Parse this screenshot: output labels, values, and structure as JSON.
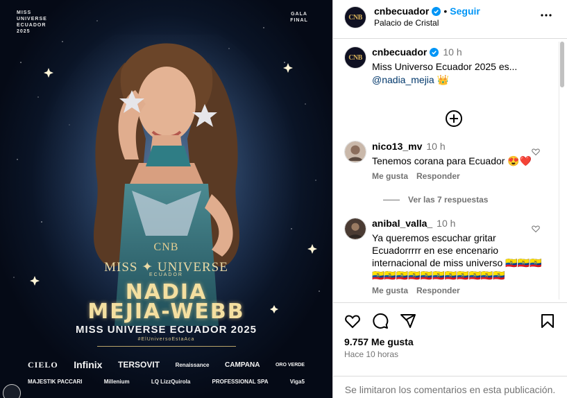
{
  "poster": {
    "corner_left": "MISS\nUNIVERSE\nECUADOR\n2025",
    "corner_right": "GALA\nFINAL",
    "cnb_logo": "CNB",
    "mu_line": "MISS ✦ UNIVERSE",
    "mu_sub": "ECUADOR",
    "name_line1": "NADIA",
    "name_line2": "MEJIA-WEBB",
    "title_line": "MISS UNIVERSE ECUADOR 2025",
    "hashtag": "#ElUniversoEstaAca",
    "sponsors_row1": [
      "CIELO",
      "Infinix",
      "TERSOVIT",
      "Renaissance",
      "CAMPANA",
      "ORO VERDE"
    ],
    "sponsors_row2": [
      "MAJESTIK PACCARI",
      "Millenium",
      "LQ LizzQuirola",
      "PROFESSIONAL SPA",
      "Viga5"
    ]
  },
  "header": {
    "avatar_text": "CNB",
    "username": "cnbecuador",
    "follow_label": "Seguir",
    "location": "Palacio de Cristal"
  },
  "caption": {
    "username": "cnbecuador",
    "time": "10 h",
    "text": "Miss Universo Ecuador 2025 es...",
    "mention": "@nadia_mejia",
    "emoji": "👑"
  },
  "comments": [
    {
      "username": "nico13_mv",
      "time": "10 h",
      "text": "Tenemos corana para Ecuador 😍❤️",
      "like_label": "Me gusta",
      "reply_label": "Responder",
      "view_replies": "Ver las 7 respuestas"
    },
    {
      "username": "anibal_valla_",
      "time": "10 h",
      "text": "Ya queremos escuchar gritar Ecuadorrrrr en ese encenario internacional de miss universo 🇪🇨🇪🇨🇪🇨🇪🇨🇪🇨🇪🇨🇪🇨🇪🇨🇪🇨🇪🇨🇪🇨🇪🇨🇪🇨🇪🇨",
      "like_label": "Me gusta",
      "reply_label": "Responder"
    }
  ],
  "footer": {
    "likes": "9.757 Me gusta",
    "ago": "Hace 10 horas",
    "limited": "Se limitaron los comentarios en esta publicación."
  },
  "colors": {
    "accent": "#0095f6",
    "mention": "#00376b",
    "muted": "#737373",
    "border": "#dbdbdb"
  }
}
